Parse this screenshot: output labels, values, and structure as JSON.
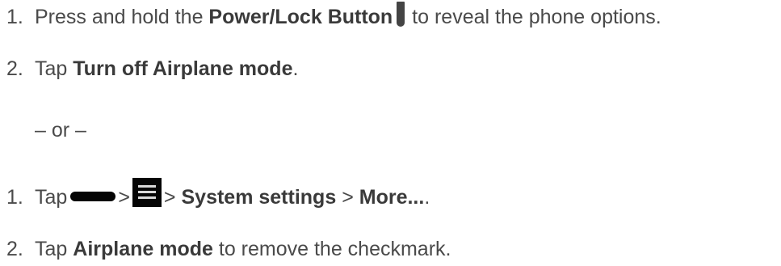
{
  "steps_a": [
    {
      "number": "1.",
      "pre": "Press and hold the ",
      "bold": "Power/Lock Button",
      "post": " to reveal the phone options."
    },
    {
      "number": "2.",
      "pre": "Tap ",
      "bold": "Turn off Airplane mode",
      "post": "."
    }
  ],
  "separator": "– or –",
  "steps_b": [
    {
      "number": "1.",
      "tap": "Tap",
      "sep1": ">",
      "sep2": ">",
      "bold1": "System settings",
      "sep3": ">",
      "bold2": "More...",
      "post": "."
    },
    {
      "number": "2.",
      "pre": "Tap ",
      "bold": "Airplane mode",
      "post": " to remove the checkmark."
    }
  ],
  "icons": {
    "power_button": "power-button-icon",
    "home": "home-button-icon",
    "menu": "menu-icon"
  }
}
